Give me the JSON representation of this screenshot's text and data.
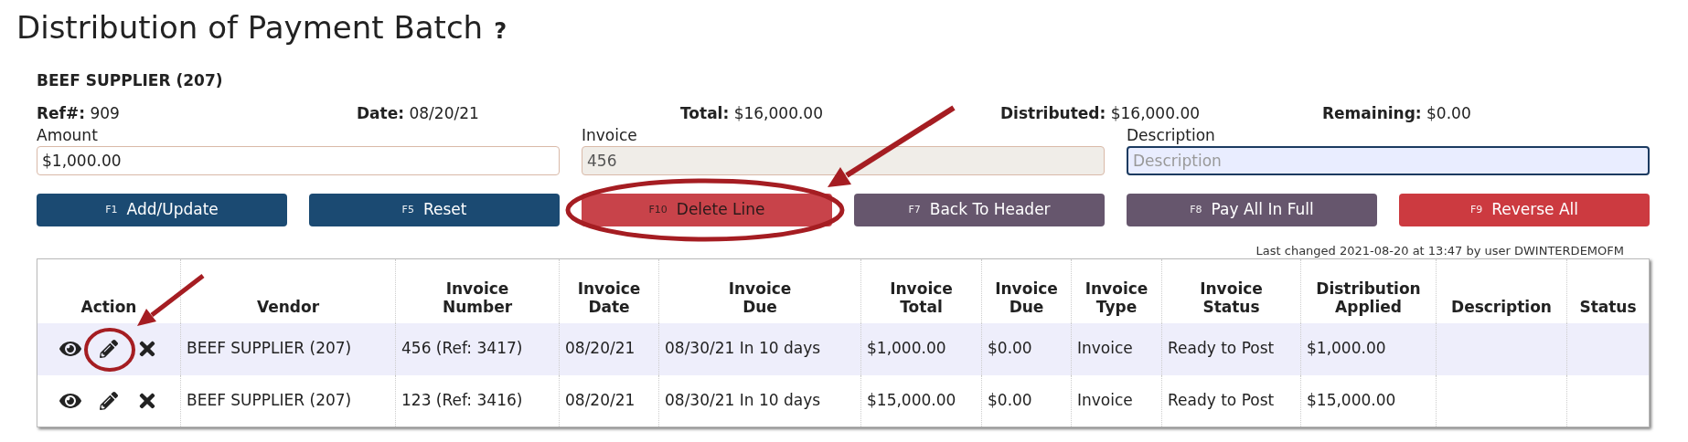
{
  "page": {
    "title": "Distribution of Payment Batch",
    "help": "?"
  },
  "batch": {
    "vendor": "BEEF SUPPLIER (207)",
    "summary": [
      {
        "label": "Ref#:",
        "value": "909"
      },
      {
        "label": "Date:",
        "value": "08/20/21"
      },
      {
        "label": "Total:",
        "value": "$16,000.00"
      },
      {
        "label": "Distributed:",
        "value": "$16,000.00"
      },
      {
        "label": "Remaining:",
        "value": "$0.00"
      }
    ]
  },
  "fields": [
    {
      "label": "Amount",
      "value": "$1,000.00",
      "disabled": false,
      "focused": false
    },
    {
      "label": "Invoice",
      "value": "456",
      "disabled": true,
      "focused": false
    },
    {
      "label": "Description",
      "placeholder": "Description",
      "disabled": false,
      "focused": true
    }
  ],
  "buttons": [
    {
      "key": "F1",
      "label": "Add/Update",
      "kind": "primary"
    },
    {
      "key": "F5",
      "label": "Reset",
      "kind": "primary"
    },
    {
      "key": "F10",
      "label": "Delete Line",
      "kind": "delete"
    },
    {
      "key": "F7",
      "label": "Back To Header",
      "kind": "secondary"
    },
    {
      "key": "F8",
      "label": "Pay All In Full",
      "kind": "secondary"
    },
    {
      "key": "F9",
      "label": "Reverse All",
      "kind": "danger"
    }
  ],
  "last_changed": "Last changed 2021-08-20 at 13:47 by user DWINTERDEMOFM",
  "table": {
    "columns": [
      "Action",
      "Vendor",
      "Invoice Number",
      "Invoice Date",
      "Invoice Due",
      "Invoice Total",
      "Invoice Due",
      "Invoice Type",
      "Invoice Status",
      "Distribution Applied",
      "Description",
      "Status"
    ],
    "rows": [
      {
        "selected": true,
        "cells": [
          "",
          "BEEF SUPPLIER (207)",
          "456 (Ref: 3417)",
          "08/20/21",
          "08/30/21 In 10 days",
          "$1,000.00",
          "$0.00",
          "Invoice",
          "Ready to Post",
          "$1,000.00",
          "",
          ""
        ]
      },
      {
        "selected": false,
        "cells": [
          "",
          "BEEF SUPPLIER (207)",
          "123 (Ref: 3416)",
          "08/20/21",
          "08/30/21 In 10 days",
          "$15,000.00",
          "$0.00",
          "Invoice",
          "Ready to Post",
          "$15,000.00",
          "",
          ""
        ]
      }
    ]
  }
}
